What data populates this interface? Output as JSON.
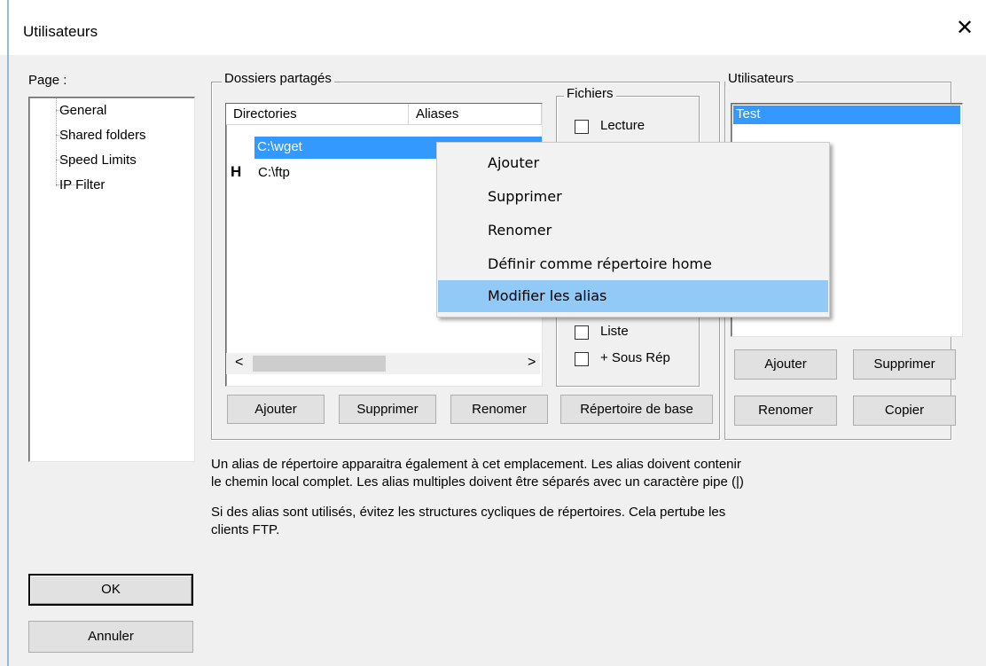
{
  "window": {
    "title": "Utilisateurs",
    "close_glyph": "✕"
  },
  "page_panel": {
    "label": "Page :",
    "items": [
      "General",
      "Shared folders",
      "Speed Limits",
      "IP Filter"
    ]
  },
  "shared": {
    "legend": "Dossiers partagés",
    "columns": [
      "Directories",
      "Aliases"
    ],
    "rows": [
      {
        "marker": "",
        "path": "C:\\wget",
        "selected": true
      },
      {
        "marker": "H",
        "path": "C:\\ftp",
        "selected": false
      }
    ],
    "scroll_left": "<",
    "scroll_right": ">",
    "buttons": [
      "Ajouter",
      "Supprimer",
      "Renomer",
      "Répertoire de base"
    ]
  },
  "fichiers": {
    "legend": "Fichiers",
    "lecture": "Lecture",
    "liste": "Liste",
    "sous_rep": "+ Sous Rép"
  },
  "users": {
    "legend": "Utilisateurs",
    "items": [
      "Test"
    ],
    "buttons": [
      "Ajouter",
      "Supprimer",
      "Renomer",
      "Copier"
    ]
  },
  "context_menu": {
    "items": [
      "Ajouter",
      "Supprimer",
      "Renomer",
      "Définir comme répertoire home",
      "Modifier les alias"
    ],
    "highlighted": "Modifier les alias"
  },
  "info": {
    "line1": "Un alias de répertoire apparaitra également à cet emplacement. Les alias doivent contenir",
    "line2": "le chemin local complet. Les alias multiples doivent être séparés avec un caractère pipe (|)",
    "line3": "Si des alias sont utilisés, évitez les structures cycliques de répertoires. Cela pertube les",
    "line4": "clients FTP."
  },
  "footer": {
    "ok": "OK",
    "cancel": "Annuler"
  }
}
